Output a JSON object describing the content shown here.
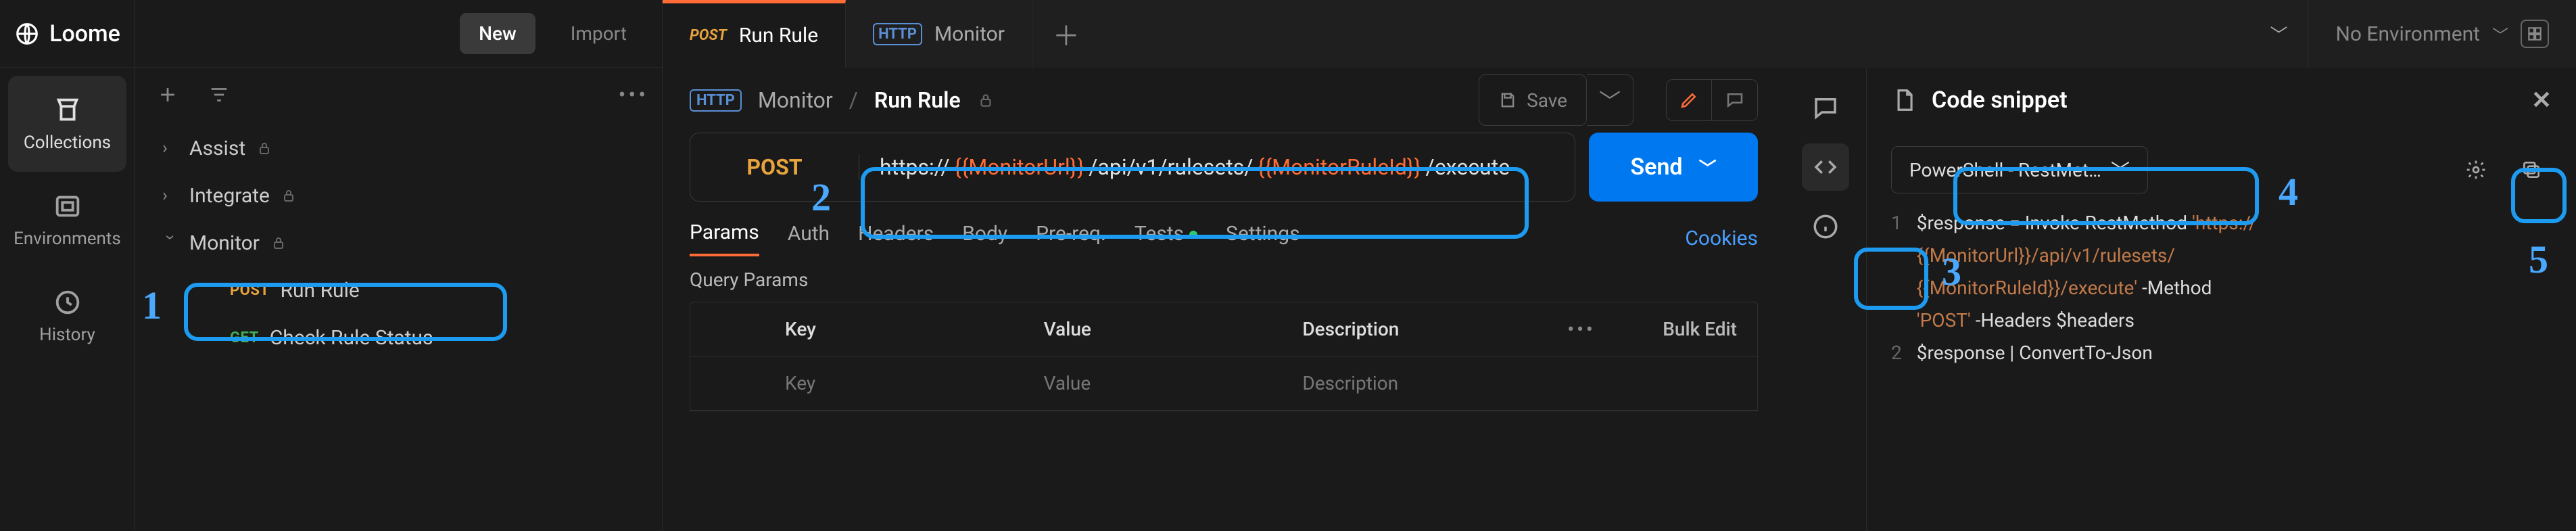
{
  "app": {
    "name": "Loome"
  },
  "rail": {
    "items": [
      {
        "id": "collections",
        "label": "Collections",
        "active": true
      },
      {
        "id": "environments",
        "label": "Environments"
      },
      {
        "id": "history",
        "label": "History"
      }
    ]
  },
  "sidebar": {
    "new_label": "New",
    "import_label": "Import",
    "tree": [
      {
        "label": "Assist",
        "locked": true,
        "expanded": false
      },
      {
        "label": "Integrate",
        "locked": true,
        "expanded": false
      },
      {
        "label": "Monitor",
        "locked": true,
        "expanded": true,
        "children": [
          {
            "method": "POST",
            "label": "Run Rule",
            "active": true
          },
          {
            "method": "GET",
            "label": "Check Rule Status"
          }
        ]
      }
    ]
  },
  "tabs": {
    "items": [
      {
        "method": "POST",
        "label": "Run Rule",
        "active": true
      },
      {
        "http_icon": true,
        "label": "Monitor"
      }
    ],
    "dropdown_caret": true,
    "environment": {
      "label": "No Environment"
    }
  },
  "breadcrumb": {
    "http_icon": true,
    "parent": "Monitor",
    "current": "Run Rule",
    "locked": true
  },
  "header_actions": {
    "save_label": "Save"
  },
  "request": {
    "method": "POST",
    "url_parts": [
      {
        "t": "text",
        "v": "https://"
      },
      {
        "t": "var",
        "v": "{{MonitorUrl}}"
      },
      {
        "t": "text",
        "v": "/api/v1/rulesets/"
      },
      {
        "t": "var",
        "v": "{{MonitorRuleId}}"
      },
      {
        "t": "text",
        "v": "/execute"
      }
    ],
    "send_label": "Send"
  },
  "subtabs": {
    "items": [
      "Params",
      "Auth",
      "Headers",
      "Body",
      "Pre-req.",
      "Tests",
      "Settings"
    ],
    "active": "Params",
    "tests_dot": true,
    "cookies_label": "Cookies"
  },
  "query_params": {
    "title": "Query Params",
    "columns": [
      "Key",
      "Value",
      "Description"
    ],
    "bulk_edit_label": "Bulk Edit",
    "placeholder_row": {
      "key": "Key",
      "value": "Value",
      "description": "Description"
    }
  },
  "snippet": {
    "title": "Code snippet",
    "language": "PowerShell - RestMet…",
    "code_lines": [
      "$response = Invoke-RestMethod 'https://{{MonitorUrl}}/api/v1/rulesets/{{MonitorRuleId}}/execute' -Method 'POST' -Headers $headers",
      "$response | ConvertTo-Json"
    ]
  },
  "callouts": [
    "1",
    "2",
    "3",
    "4",
    "5"
  ]
}
